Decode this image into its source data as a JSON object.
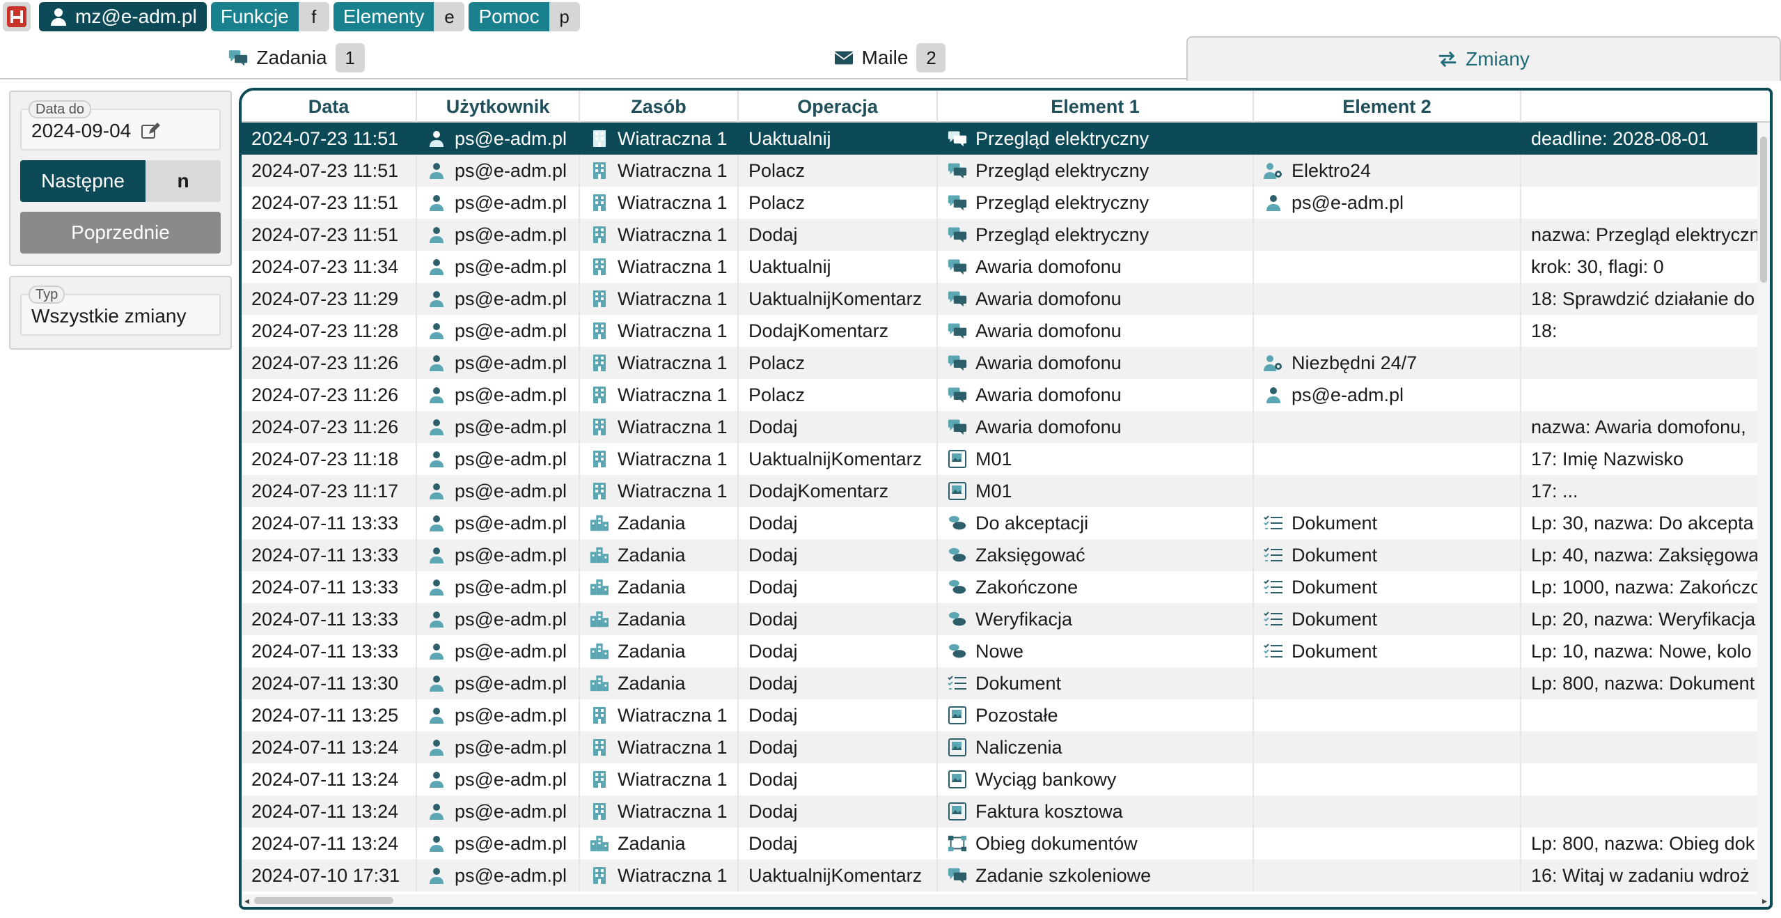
{
  "topbar": {
    "user": "mz@e-adm.pl",
    "menus": [
      {
        "label": "Funkcje",
        "key": "f"
      },
      {
        "label": "Elementy",
        "key": "e"
      },
      {
        "label": "Pomoc",
        "key": "p"
      }
    ]
  },
  "tabs": [
    {
      "label": "Zadania",
      "count": "1",
      "icon": "chat-icon"
    },
    {
      "label": "Maile",
      "count": "2",
      "icon": "mail-icon"
    },
    {
      "label": "Zmiany",
      "count": "",
      "icon": "swap-icon"
    }
  ],
  "filters": {
    "date_label": "Data do",
    "date_value": "2024-09-04",
    "next_label": "Następne",
    "next_key": "n",
    "prev_label": "Poprzednie",
    "type_label": "Typ",
    "type_value": "Wszystkie zmiany"
  },
  "table": {
    "columns": [
      "Data",
      "Użytkownik",
      "Zasób",
      "Operacja",
      "Element 1",
      "Element 2",
      ""
    ],
    "rows": [
      {
        "date": "2024-07-23 11:51",
        "user": "ps@e-adm.pl",
        "res": "Wiatraczna 1",
        "res_icon": "building",
        "op": "Uaktualnij",
        "e1": "Przegląd elektryczny",
        "e1_icon": "chat",
        "e2": "",
        "e2_icon": "",
        "det": "deadline: 2028-08-01"
      },
      {
        "date": "2024-07-23 11:51",
        "user": "ps@e-adm.pl",
        "res": "Wiatraczna 1",
        "res_icon": "building",
        "op": "Polacz",
        "e1": "Przegląd elektryczny",
        "e1_icon": "chat",
        "e2": "Elektro24",
        "e2_icon": "usergear",
        "det": ""
      },
      {
        "date": "2024-07-23 11:51",
        "user": "ps@e-adm.pl",
        "res": "Wiatraczna 1",
        "res_icon": "building",
        "op": "Polacz",
        "e1": "Przegląd elektryczny",
        "e1_icon": "chat",
        "e2": "ps@e-adm.pl",
        "e2_icon": "user",
        "det": ""
      },
      {
        "date": "2024-07-23 11:51",
        "user": "ps@e-adm.pl",
        "res": "Wiatraczna 1",
        "res_icon": "building",
        "op": "Dodaj",
        "e1": "Przegląd elektryczny",
        "e1_icon": "chat",
        "e2": "",
        "e2_icon": "",
        "det": "nazwa: Przegląd elektryczn"
      },
      {
        "date": "2024-07-23 11:34",
        "user": "ps@e-adm.pl",
        "res": "Wiatraczna 1",
        "res_icon": "building",
        "op": "Uaktualnij",
        "e1": "Awaria domofonu",
        "e1_icon": "chat",
        "e2": "",
        "e2_icon": "",
        "det": "krok: 30, flagi: 0"
      },
      {
        "date": "2024-07-23 11:29",
        "user": "ps@e-adm.pl",
        "res": "Wiatraczna 1",
        "res_icon": "building",
        "op": "UaktualnijKomentarz",
        "e1": "Awaria domofonu",
        "e1_icon": "chat",
        "e2": "",
        "e2_icon": "",
        "det": "18: Sprawdzić działanie do"
      },
      {
        "date": "2024-07-23 11:28",
        "user": "ps@e-adm.pl",
        "res": "Wiatraczna 1",
        "res_icon": "building",
        "op": "DodajKomentarz",
        "e1": "Awaria domofonu",
        "e1_icon": "chat",
        "e2": "",
        "e2_icon": "",
        "det": "18:"
      },
      {
        "date": "2024-07-23 11:26",
        "user": "ps@e-adm.pl",
        "res": "Wiatraczna 1",
        "res_icon": "building",
        "op": "Polacz",
        "e1": "Awaria domofonu",
        "e1_icon": "chat",
        "e2": "Niezbędni 24/7",
        "e2_icon": "usergear",
        "det": ""
      },
      {
        "date": "2024-07-23 11:26",
        "user": "ps@e-adm.pl",
        "res": "Wiatraczna 1",
        "res_icon": "building",
        "op": "Polacz",
        "e1": "Awaria domofonu",
        "e1_icon": "chat",
        "e2": "ps@e-adm.pl",
        "e2_icon": "user",
        "det": ""
      },
      {
        "date": "2024-07-23 11:26",
        "user": "ps@e-adm.pl",
        "res": "Wiatraczna 1",
        "res_icon": "building",
        "op": "Dodaj",
        "e1": "Awaria domofonu",
        "e1_icon": "chat",
        "e2": "",
        "e2_icon": "",
        "det": "nazwa: Awaria domofonu,"
      },
      {
        "date": "2024-07-23 11:18",
        "user": "ps@e-adm.pl",
        "res": "Wiatraczna 1",
        "res_icon": "building",
        "op": "UaktualnijKomentarz",
        "e1": "M01",
        "e1_icon": "image",
        "e2": "",
        "e2_icon": "",
        "det": "17: Imię Nazwisko"
      },
      {
        "date": "2024-07-23 11:17",
        "user": "ps@e-adm.pl",
        "res": "Wiatraczna 1",
        "res_icon": "building",
        "op": "DodajKomentarz",
        "e1": "M01",
        "e1_icon": "image",
        "e2": "",
        "e2_icon": "",
        "det": "17: ..."
      },
      {
        "date": "2024-07-11 13:33",
        "user": "ps@e-adm.pl",
        "res": "Zadania",
        "res_icon": "city",
        "op": "Dodaj",
        "e1": "Do akceptacji",
        "e1_icon": "steps",
        "e2": "Dokument",
        "e2_icon": "list",
        "det": "Lp: 30, nazwa: Do akcepta"
      },
      {
        "date": "2024-07-11 13:33",
        "user": "ps@e-adm.pl",
        "res": "Zadania",
        "res_icon": "city",
        "op": "Dodaj",
        "e1": "Zaksięgować",
        "e1_icon": "steps",
        "e2": "Dokument",
        "e2_icon": "list",
        "det": "Lp: 40, nazwa: Zaksięgowa"
      },
      {
        "date": "2024-07-11 13:33",
        "user": "ps@e-adm.pl",
        "res": "Zadania",
        "res_icon": "city",
        "op": "Dodaj",
        "e1": "Zakończone",
        "e1_icon": "steps",
        "e2": "Dokument",
        "e2_icon": "list",
        "det": "Lp: 1000, nazwa: Zakończo"
      },
      {
        "date": "2024-07-11 13:33",
        "user": "ps@e-adm.pl",
        "res": "Zadania",
        "res_icon": "city",
        "op": "Dodaj",
        "e1": "Weryfikacja",
        "e1_icon": "steps",
        "e2": "Dokument",
        "e2_icon": "list",
        "det": "Lp: 20, nazwa: Weryfikacja"
      },
      {
        "date": "2024-07-11 13:33",
        "user": "ps@e-adm.pl",
        "res": "Zadania",
        "res_icon": "city",
        "op": "Dodaj",
        "e1": "Nowe",
        "e1_icon": "steps",
        "e2": "Dokument",
        "e2_icon": "list",
        "det": "Lp: 10, nazwa: Nowe, kolo"
      },
      {
        "date": "2024-07-11 13:30",
        "user": "ps@e-adm.pl",
        "res": "Zadania",
        "res_icon": "city",
        "op": "Dodaj",
        "e1": "Dokument",
        "e1_icon": "list",
        "e2": "",
        "e2_icon": "",
        "det": "Lp: 800, nazwa: Dokument"
      },
      {
        "date": "2024-07-11 13:25",
        "user": "ps@e-adm.pl",
        "res": "Wiatraczna 1",
        "res_icon": "building",
        "op": "Dodaj",
        "e1": "Pozostałe",
        "e1_icon": "image",
        "e2": "",
        "e2_icon": "",
        "det": ""
      },
      {
        "date": "2024-07-11 13:24",
        "user": "ps@e-adm.pl",
        "res": "Wiatraczna 1",
        "res_icon": "building",
        "op": "Dodaj",
        "e1": "Naliczenia",
        "e1_icon": "image",
        "e2": "",
        "e2_icon": "",
        "det": ""
      },
      {
        "date": "2024-07-11 13:24",
        "user": "ps@e-adm.pl",
        "res": "Wiatraczna 1",
        "res_icon": "building",
        "op": "Dodaj",
        "e1": "Wyciąg bankowy",
        "e1_icon": "image",
        "e2": "",
        "e2_icon": "",
        "det": ""
      },
      {
        "date": "2024-07-11 13:24",
        "user": "ps@e-adm.pl",
        "res": "Wiatraczna 1",
        "res_icon": "building",
        "op": "Dodaj",
        "e1": "Faktura kosztowa",
        "e1_icon": "image",
        "e2": "",
        "e2_icon": "",
        "det": ""
      },
      {
        "date": "2024-07-11 13:24",
        "user": "ps@e-adm.pl",
        "res": "Zadania",
        "res_icon": "city",
        "op": "Dodaj",
        "e1": "Obieg dokumentów",
        "e1_icon": "flow",
        "e2": "",
        "e2_icon": "",
        "det": "Lp: 800, nazwa: Obieg dok"
      },
      {
        "date": "2024-07-10 17:31",
        "user": "ps@e-adm.pl",
        "res": "Wiatraczna 1",
        "res_icon": "building",
        "op": "UaktualnijKomentarz",
        "e1": "Zadanie szkoleniowe",
        "e1_icon": "chat",
        "e2": "",
        "e2_icon": "",
        "det": "16: Witaj w zadaniu wdroż"
      }
    ]
  },
  "colors": {
    "primary": "#0d4a57",
    "teal": "#19808e",
    "icon": "#5aa7b3",
    "gray_button": "#8a8a8a"
  }
}
